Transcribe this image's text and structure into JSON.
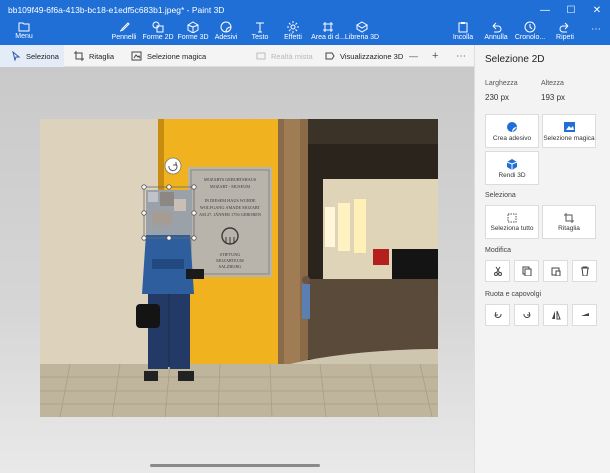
{
  "window": {
    "title": "bb109f49-6f6a-413b-bc18-e1edf5c683b1.jpeg* - Paint 3D",
    "minimize_glyph": "—",
    "maximize_glyph": "☐",
    "close_glyph": "✕"
  },
  "ribbon": {
    "menu": "Menu",
    "tools": [
      {
        "label": "Pennelli",
        "icon": "brush-icon"
      },
      {
        "label": "Forme 2D",
        "icon": "shapes-2d-icon"
      },
      {
        "label": "Forme 3D",
        "icon": "shapes-3d-icon"
      },
      {
        "label": "Adesivi",
        "icon": "sticker-icon"
      },
      {
        "label": "Testo",
        "icon": "text-icon"
      },
      {
        "label": "Effetti",
        "icon": "effects-icon"
      },
      {
        "label": "Area di d...",
        "icon": "canvas-icon"
      },
      {
        "label": "Libreria 3D",
        "icon": "library-3d-icon"
      }
    ],
    "right_tools": [
      {
        "label": "Incolla",
        "icon": "paste-icon"
      },
      {
        "label": "Annulla",
        "icon": "undo-icon"
      },
      {
        "label": "Cronolo...",
        "icon": "history-icon"
      },
      {
        "label": "Ripeti",
        "icon": "redo-icon"
      }
    ]
  },
  "toolbar": {
    "select": "Seleziona",
    "crop": "Ritaglia",
    "magic_select": "Selezione magica",
    "mixed_reality": "Realtà mista",
    "view_3d": "Visualizzazione 3D",
    "zoom_out": "—",
    "zoom_in": "+",
    "more": "⋯"
  },
  "panel": {
    "title": "Selezione 2D",
    "width_label": "Larghezza",
    "width_value": "230 px",
    "height_label": "Altezza",
    "height_value": "193 px",
    "actions": [
      {
        "label": "Crea adesivo",
        "icon": "sticker-create-icon"
      },
      {
        "label": "Selezione magica",
        "icon": "magic-select-icon"
      },
      {
        "label": "Rendi 3D",
        "icon": "make-3d-icon"
      }
    ],
    "select_section": "Seleziona",
    "select_actions": [
      {
        "label": "Seleziona tutto",
        "icon": "select-all-icon"
      },
      {
        "label": "Ritaglia",
        "icon": "crop-icon"
      }
    ],
    "modify_section": "Modifica",
    "modify_actions": [
      "cut-icon",
      "copy-icon",
      "paste-icon",
      "delete-icon"
    ],
    "rotate_section": "Ruota e capovolgi",
    "rotate_actions": [
      "rotate-left-icon",
      "rotate-right-icon",
      "flip-vertical-icon",
      "flip-horizontal-icon"
    ]
  },
  "photo": {
    "plaque_lines": [
      "MOZARTS GEBURTSHAUS",
      "MOZART - MUSEUM",
      "IN DIESEM HAUS WURDE",
      "WOLFGANG AMADE MOZART",
      "AM 27. JÄNNER 1756 GEBOREN",
      "STIFTUNG",
      "MOZARTEUM",
      "SALZBURG"
    ],
    "colors": {
      "wall": "#f0b21e",
      "stone": "#bfb59d",
      "sky": "#1f6fd6"
    }
  }
}
